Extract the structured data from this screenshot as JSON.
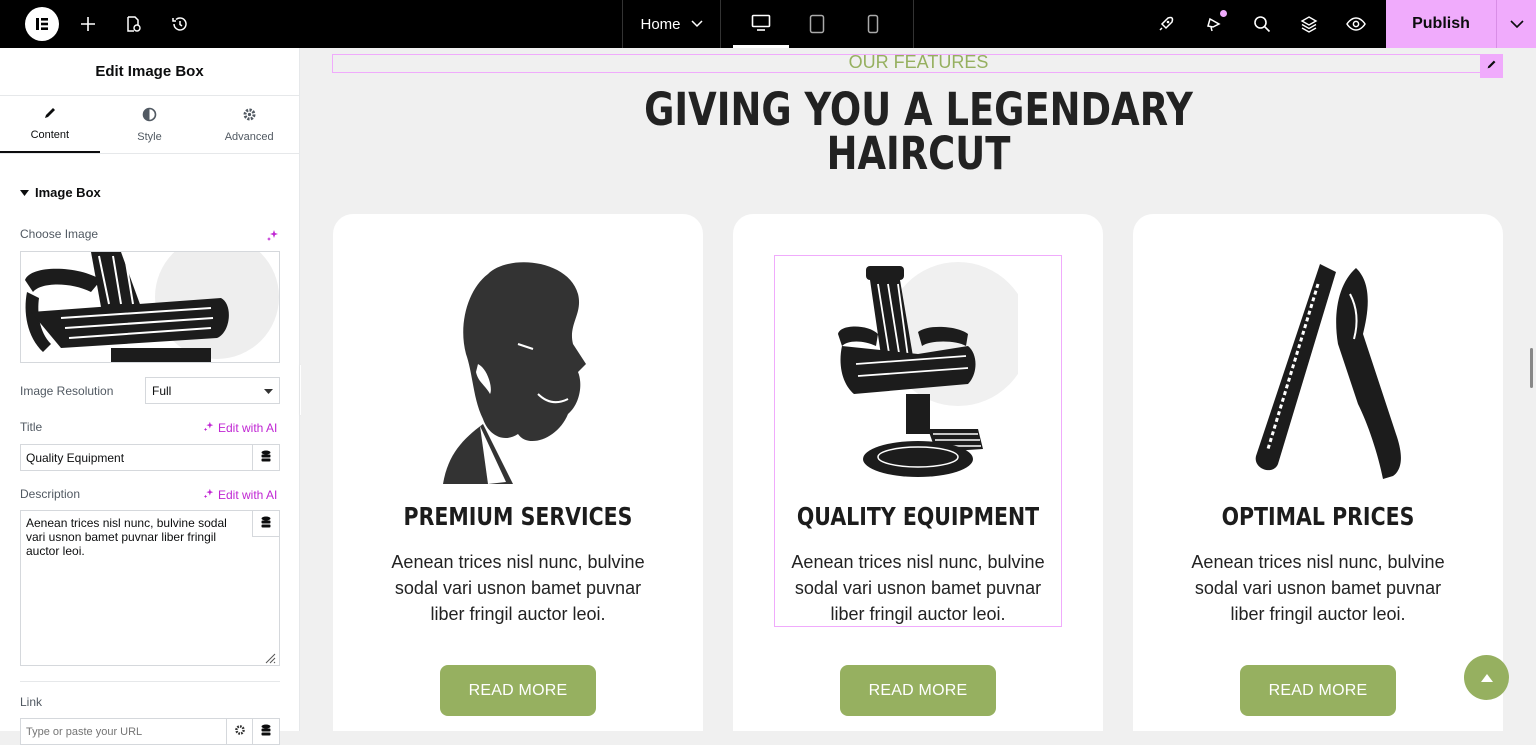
{
  "topbar": {
    "page_selector": "Home",
    "publish_label": "Publish",
    "icons": [
      "elementor-logo-icon",
      "add-icon",
      "page-settings-icon",
      "history-icon",
      "chevron-down-icon",
      "desktop-icon",
      "tablet-icon",
      "mobile-icon",
      "rocket-icon",
      "notifications-icon",
      "search-icon",
      "layers-icon",
      "preview-eye-icon"
    ],
    "colors": {
      "bar": "#000000",
      "publish": "#f0abfc"
    }
  },
  "panel": {
    "title": "Edit Image Box",
    "tabs": [
      {
        "label": "Content",
        "icon": "pencil-icon",
        "active": true
      },
      {
        "label": "Style",
        "icon": "half-circle-icon",
        "active": false
      },
      {
        "label": "Advanced",
        "icon": "gear-icon",
        "active": false
      }
    ],
    "section": "Image Box",
    "choose_image_label": "Choose Image",
    "image_resolution_label": "Image Resolution",
    "image_resolution_value": "Full",
    "title_label": "Title",
    "edit_with_ai": "Edit with AI",
    "title_value": "Quality Equipment",
    "description_label": "Description",
    "description_value": "Aenean trices nisl nunc, bulvine sodal vari usnon bamet puvnar liber fringil auctor leoi.",
    "link_label": "Link",
    "link_placeholder": "Type or paste your URL"
  },
  "canvas": {
    "eyebrow": "OUR FEATURES",
    "heading_line1": "GIVING YOU A LEGENDARY",
    "heading_line2": "HAIRCUT",
    "cards": [
      {
        "title": "PREMIUM SERVICES",
        "desc": "Aenean trices nisl nunc, bulvine sodal vari usnon bamet puvnar liber fringil auctor leoi.",
        "button": "READ MORE",
        "icon": "bearded-man-icon"
      },
      {
        "title": "QUALITY EQUIPMENT",
        "desc": "Aenean trices nisl nunc, bulvine sodal vari usnon bamet puvnar liber fringil auctor leoi.",
        "button": "READ MORE",
        "icon": "barber-chair-icon"
      },
      {
        "title": "OPTIMAL PRICES",
        "desc": "Aenean trices nisl nunc, bulvine sodal vari usnon bamet puvnar liber fringil auctor leoi.",
        "button": "READ MORE",
        "icon": "straight-razor-icon"
      }
    ],
    "colors": {
      "accent": "#96b060",
      "selection": "#f0abfc",
      "background": "#f0f0f0"
    }
  }
}
